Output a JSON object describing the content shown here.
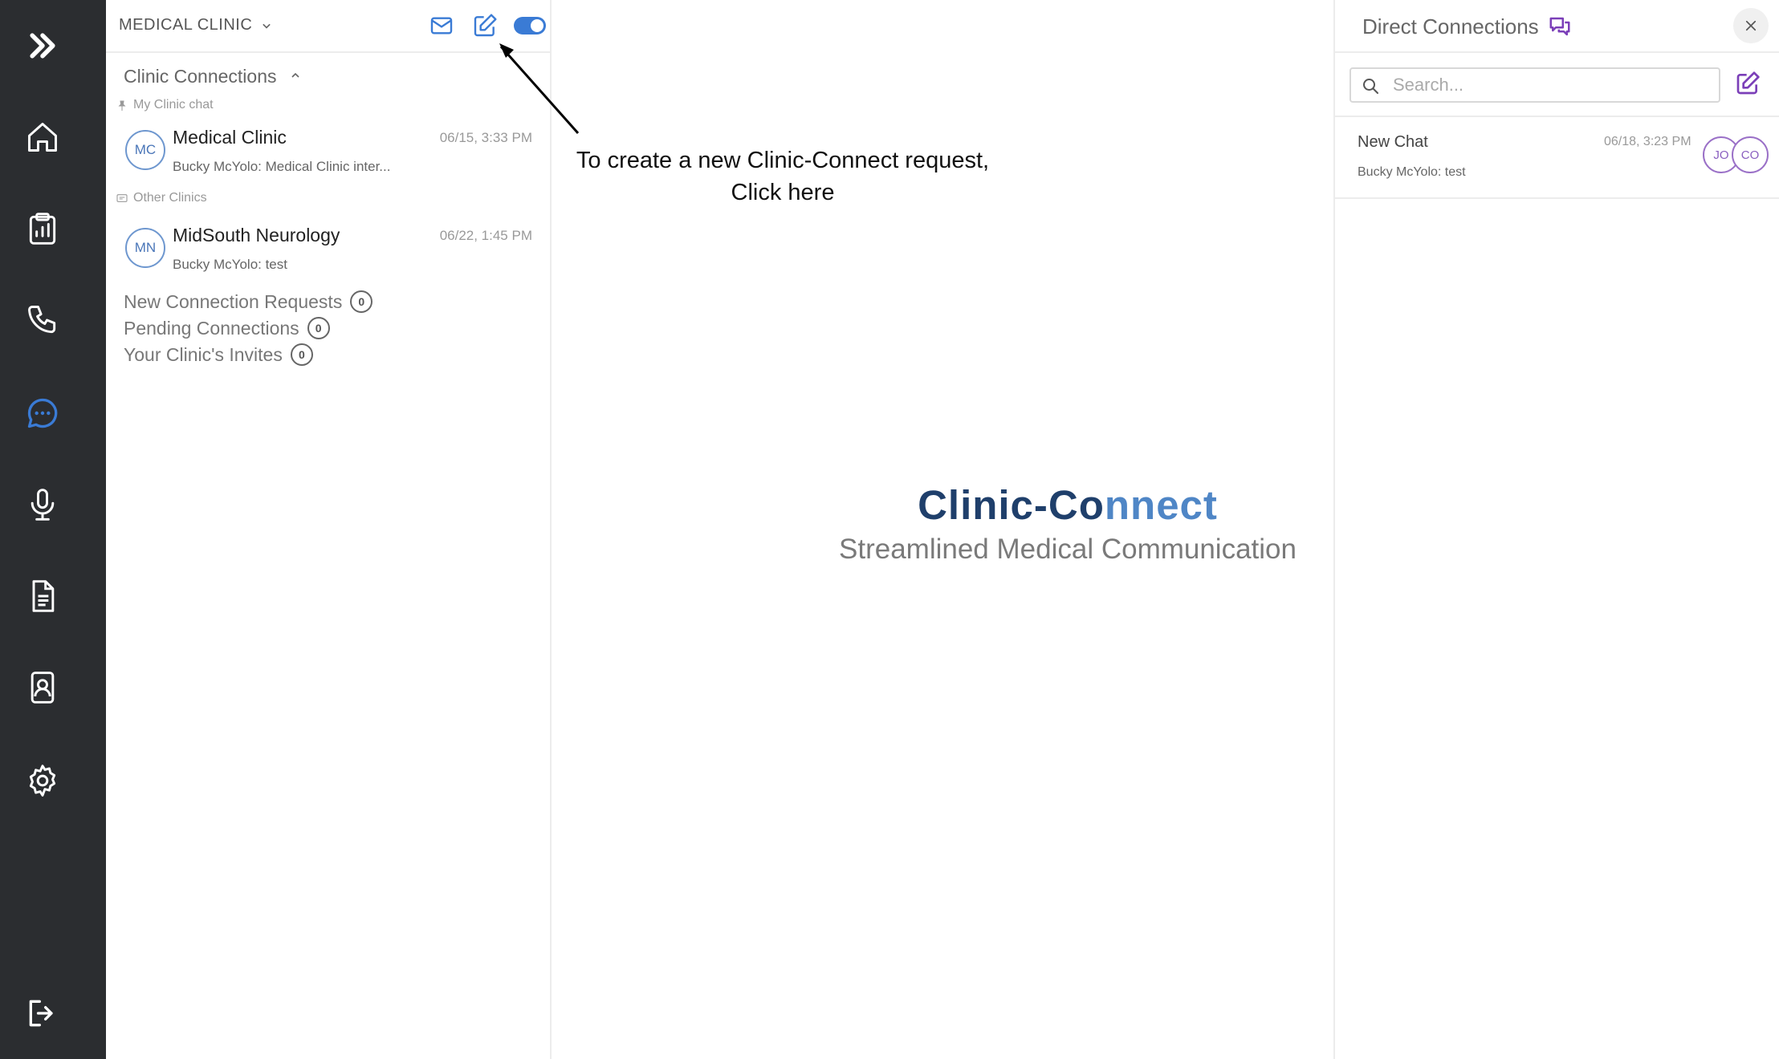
{
  "colors": {
    "rail_bg": "#2b2d30",
    "accent_blue": "#3a7bd5",
    "accent_purple": "#7b3fb8",
    "active_icon": "#3a7bd5"
  },
  "rail": {
    "items": [
      {
        "icon": "chevrons-right-icon"
      },
      {
        "icon": "home-icon"
      },
      {
        "icon": "clipboard-chart-icon"
      },
      {
        "icon": "phone-icon"
      },
      {
        "icon": "chat-bubble-icon",
        "active": true
      },
      {
        "icon": "microphone-icon"
      },
      {
        "icon": "document-icon"
      },
      {
        "icon": "contact-card-icon"
      },
      {
        "icon": "gear-icon"
      },
      {
        "icon": "logout-icon"
      }
    ]
  },
  "left": {
    "clinic_name": "MEDICAL CLINIC",
    "section_title": "Clinic Connections",
    "my_clinic_label": "My Clinic chat",
    "other_label": "Other Clinics",
    "chats": [
      {
        "initials": "MC",
        "name": "Medical Clinic",
        "time": "06/15, 3:33 PM",
        "message": "Bucky McYolo: Medical Clinic inter..."
      },
      {
        "initials": "MN",
        "name": "MidSouth Neurology",
        "time": "06/22, 1:45 PM",
        "message": "Bucky McYolo: test"
      }
    ],
    "links": [
      {
        "label": "New Connection Requests",
        "count": "0"
      },
      {
        "label": "Pending Connections",
        "count": "0"
      },
      {
        "label": "Your Clinic's Invites",
        "count": "0"
      }
    ]
  },
  "annotation": {
    "line1": "To create a new Clinic-Connect request,",
    "line2": "Click here"
  },
  "brand": {
    "title_part1": "Clinic-Co",
    "title_part2": "nnect",
    "subtitle": "Streamlined Medical Communication"
  },
  "right": {
    "title": "Direct Connections",
    "search_placeholder": "Search...",
    "chat": {
      "name": "New Chat",
      "time": "06/18, 3:23 PM",
      "message": "Bucky McYolo: test",
      "avatars": [
        "JO",
        "CO"
      ]
    }
  }
}
